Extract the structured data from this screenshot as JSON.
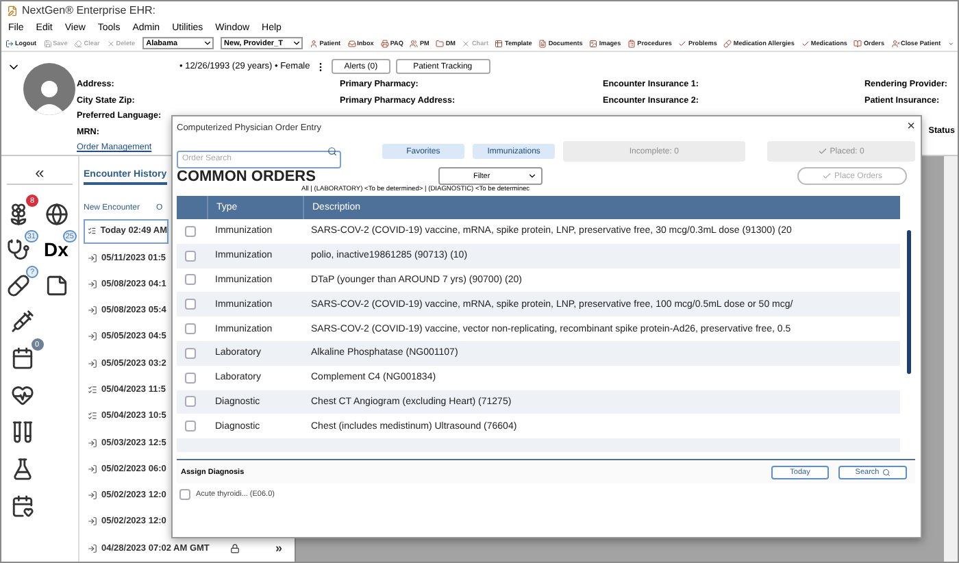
{
  "window": {
    "title": "NextGen® Enterprise EHR:"
  },
  "menu": [
    "File",
    "Edit",
    "View",
    "Tools",
    "Admin",
    "Utilities",
    "Window",
    "Help"
  ],
  "toolbar": {
    "left": [
      {
        "label": "Logout",
        "disabled": false
      },
      {
        "label": "Save",
        "disabled": true
      },
      {
        "label": "Clear",
        "disabled": true
      },
      {
        "label": "Delete",
        "disabled": true
      }
    ],
    "selects": [
      "Alabama",
      "New, Provider_T"
    ],
    "right": [
      {
        "label": "Patient",
        "disabled": false
      },
      {
        "label": "Inbox",
        "disabled": false
      },
      {
        "label": "PAQ",
        "disabled": false
      },
      {
        "label": "PM",
        "disabled": false
      },
      {
        "label": "DM",
        "disabled": false
      },
      {
        "label": "Chart",
        "disabled": true
      },
      {
        "label": "Template",
        "disabled": false
      },
      {
        "label": "Documents",
        "disabled": false
      },
      {
        "label": "Images",
        "disabled": false
      },
      {
        "label": "Procedures",
        "disabled": false
      },
      {
        "label": "Problems",
        "disabled": false
      },
      {
        "label": "Medication Allergies",
        "disabled": false
      },
      {
        "label": "Medications",
        "disabled": false
      },
      {
        "label": "Orders",
        "disabled": false
      },
      {
        "label": "Close Patient",
        "disabled": false
      }
    ]
  },
  "patient": {
    "summary": "• 12/26/1993 (29 years) • Female",
    "buttons": [
      "Alerts (0)",
      "Patient Tracking"
    ],
    "columns": [
      [
        "Address:",
        "City State Zip:",
        "Preferred Language:",
        "MRN:"
      ],
      [
        "Primary Pharmacy:",
        "Primary Pharmacy Address:"
      ],
      [
        "Encounter Insurance 1:",
        "Encounter Insurance 2:"
      ],
      [
        "Rendering Provider:",
        "Patient Insurance:"
      ]
    ],
    "status_label": "Status",
    "link": "Order Management"
  },
  "rail": {
    "collapse": "«",
    "items": [
      {
        "kind": "flower",
        "badge": "8",
        "color": "#d5303b"
      },
      {
        "kind": "globe"
      },
      {
        "kind": "stethoscope",
        "badge": "31",
        "color": "#e3eefb"
      },
      {
        "kind": "text",
        "badge": "25",
        "color": "#e3eefb",
        "text": "Dx"
      },
      {
        "kind": "pill",
        "badge": "?",
        "color": "#e3eefb"
      },
      {
        "kind": "note"
      },
      {
        "kind": "syringe"
      },
      {
        "kind": "calendar",
        "badge": "0",
        "color": "#6f8196"
      },
      {
        "kind": "heart"
      },
      {
        "kind": "tubes"
      },
      {
        "kind": "flask"
      },
      {
        "kind": "calendar-heart"
      }
    ]
  },
  "encounters": {
    "tabs": [
      {
        "label": "Encounter History",
        "selected": true
      }
    ],
    "new": "New Encounter",
    "other": "O",
    "rows": [
      {
        "text": "Today 02:49 AM",
        "kind": "note",
        "selected": true
      },
      {
        "text": "05/11/2023 01:5",
        "kind": "arrow",
        "selected": false
      },
      {
        "text": "05/08/2023 04:1",
        "kind": "arrow",
        "selected": false
      },
      {
        "text": "05/08/2023 05:4",
        "kind": "arrow",
        "selected": false
      },
      {
        "text": "05/05/2023 04:5",
        "kind": "arrow",
        "selected": false
      },
      {
        "text": "05/05/2023 03:2",
        "kind": "arrow",
        "selected": false
      },
      {
        "text": "05/04/2023 11:5",
        "kind": "note",
        "selected": false
      },
      {
        "text": "05/04/2023 10:5",
        "kind": "note",
        "selected": false
      },
      {
        "text": "05/03/2023 12:5",
        "kind": "arrow",
        "selected": false
      },
      {
        "text": "05/02/2023 06:0",
        "kind": "arrow",
        "selected": false
      },
      {
        "text": "05/02/2023 12:0",
        "kind": "arrow",
        "selected": false
      },
      {
        "text": "05/02/2023 12:0",
        "kind": "arrow",
        "selected": false
      },
      {
        "text": "04/28/2023 07:02 AM GMT",
        "kind": "arrow",
        "selected": false
      }
    ],
    "expand": "»"
  },
  "modal": {
    "title": "Computerized Physician Order Entry",
    "close": "×",
    "search": {
      "placeholder": "Order Search"
    },
    "buttons": [
      {
        "label": "Favorites",
        "disabled": false
      },
      {
        "label": "Immunizations",
        "disabled": false
      },
      {
        "label": "Incomplete: 0",
        "disabled": true
      },
      {
        "label": "Placed: 0",
        "disabled": true
      }
    ],
    "heading": "COMMON ORDERS",
    "filter": "Filter",
    "place": {
      "label": "Place Orders",
      "disabled": true
    },
    "filter_text": "All | (LABORATORY) <To be determined> | (DIAGNOSTIC) <To be determinec",
    "columns": [
      "Type",
      "Description"
    ],
    "rows": [
      {
        "type": "Immunization",
        "description": "SARS-COV-2 (COVID-19) vaccine, mRNA, spike protein, LNP, preservative free, 30 mcg/0.3mL dose (91300) (20",
        "checked": false
      },
      {
        "type": "Immunization",
        "description": "polio, inactive19861285 (90713) (10)",
        "checked": false
      },
      {
        "type": "Immunization",
        "description": "DTaP (younger than AROUND 7 yrs) (90700) (20)",
        "checked": false
      },
      {
        "type": "Immunization",
        "description": "SARS-COV-2 (COVID-19) vaccine, mRNA, spike protein, LNP, preservative free, 100 mcg/0.5mL dose or 50 mcg/",
        "checked": false
      },
      {
        "type": "Immunization",
        "description": "SARS-COV-2 (COVID-19) vaccine, vector non-replicating, recombinant spike protein-Ad26, preservative free, 0.5",
        "checked": false
      },
      {
        "type": "Laboratory",
        "description": "Alkaline Phosphatase (NG001107)",
        "checked": false
      },
      {
        "type": "Laboratory",
        "description": "Complement C4 (NG001834)",
        "checked": false
      },
      {
        "type": "Diagnostic",
        "description": "Chest CT Angiogram (excluding Heart) (71275)",
        "checked": false
      },
      {
        "type": "Diagnostic",
        "description": "Chest (includes medistinum) Ultrasound (76604)",
        "checked": false
      }
    ],
    "diagnosis": {
      "title": "Assign Diagnosis",
      "buttons": [
        "Today",
        "Search"
      ],
      "items": [
        {
          "label": "Acute thyroidi... (E06.0)",
          "checked": false
        }
      ]
    }
  }
}
